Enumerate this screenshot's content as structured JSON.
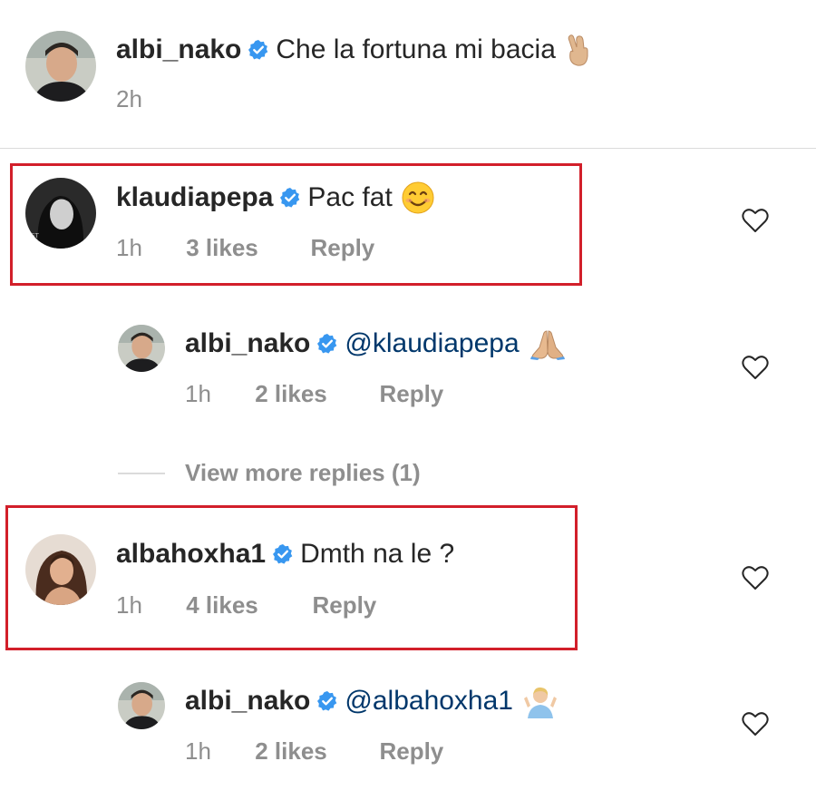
{
  "caption": {
    "username": "albi_nako",
    "text": "Che la fortuna mi bacia",
    "emoji": "crossed-fingers-emoji",
    "time": "2h"
  },
  "comments": [
    {
      "username": "klaudiapepa",
      "text": "Pac fat",
      "emoji": "smiling-face-emoji",
      "time": "1h",
      "likes": "3 likes",
      "reply_label": "Reply",
      "highlighted": true
    },
    {
      "username": "albi_nako",
      "text": "@klaudiapepa",
      "emoji": "folded-hands-emoji",
      "time": "1h",
      "likes": "2 likes",
      "reply_label": "Reply",
      "is_reply": true
    },
    {
      "view_more_label": "View more replies (1)"
    },
    {
      "username": "albahoxha1",
      "text": "Dmth na le ?",
      "time": "1h",
      "likes": "4 likes",
      "reply_label": "Reply",
      "highlighted": true
    },
    {
      "username": "albi_nako",
      "text": "@albahoxha1",
      "emoji": "person-shrugging-emoji",
      "time": "1h",
      "likes": "2 likes",
      "reply_label": "Reply",
      "is_reply": true
    }
  ],
  "colors": {
    "text": "#262626",
    "meta": "#8e8e8e",
    "mention": "#00376b",
    "verified": "#3897f0",
    "highlight_border": "#d21f2a",
    "divider": "#dbdbdb"
  }
}
